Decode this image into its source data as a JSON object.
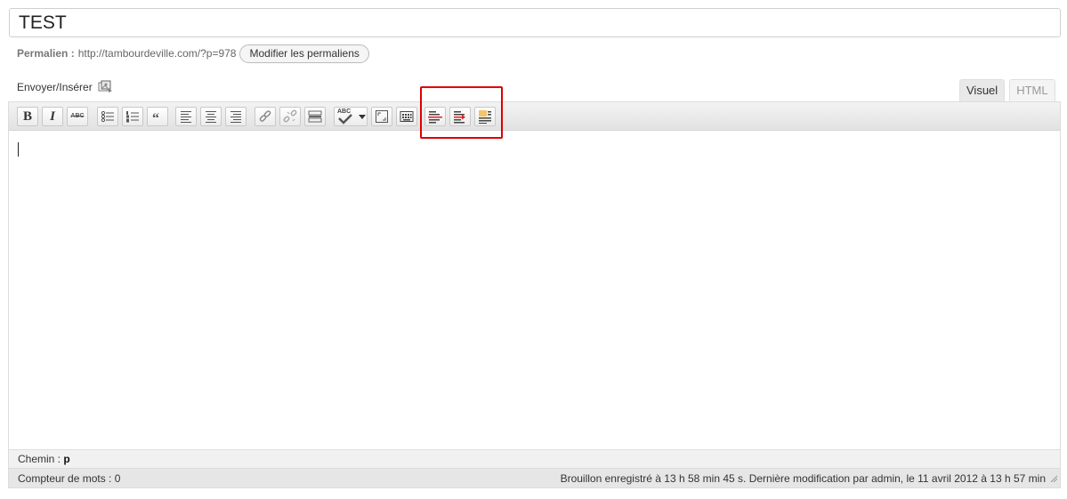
{
  "title": {
    "value": "TEST"
  },
  "permalink": {
    "label": "Permalien :",
    "url": "http://tambourdeville.com/?p=978",
    "button": "Modifier les permaliens"
  },
  "media": {
    "label": "Envoyer/Insérer",
    "icon": "media-upload-icon"
  },
  "tabs": {
    "visual": "Visuel",
    "html": "HTML"
  },
  "toolbar": {
    "bold": "B",
    "italic": "I",
    "strike": "ABC",
    "spellcheck": "ABC",
    "icons": [
      "bold-icon",
      "italic-icon",
      "strikethrough-icon",
      "bullet-list-icon",
      "numbered-list-icon",
      "blockquote-icon",
      "align-left-icon",
      "align-center-icon",
      "align-right-icon",
      "link-icon",
      "unlink-icon",
      "more-tag-icon",
      "spellcheck-icon",
      "fullscreen-icon",
      "kitchen-sink-icon",
      "strikeout-line-icon",
      "insert-line-icon",
      "highlight-line-icon"
    ]
  },
  "editor": {
    "path_label": "Chemin :",
    "path_value": "p",
    "word_count": "Compteur de mots : 0",
    "draft_status": "Brouillon enregistré à 13 h 58 min 45 s. Dernière modification par admin, le 11 avril 2012 à 13 h 57 min"
  },
  "colors": {
    "highlight_box": "#e00000",
    "toolbar_bg": "#e6e6e6",
    "border": "#dcdcdc"
  }
}
